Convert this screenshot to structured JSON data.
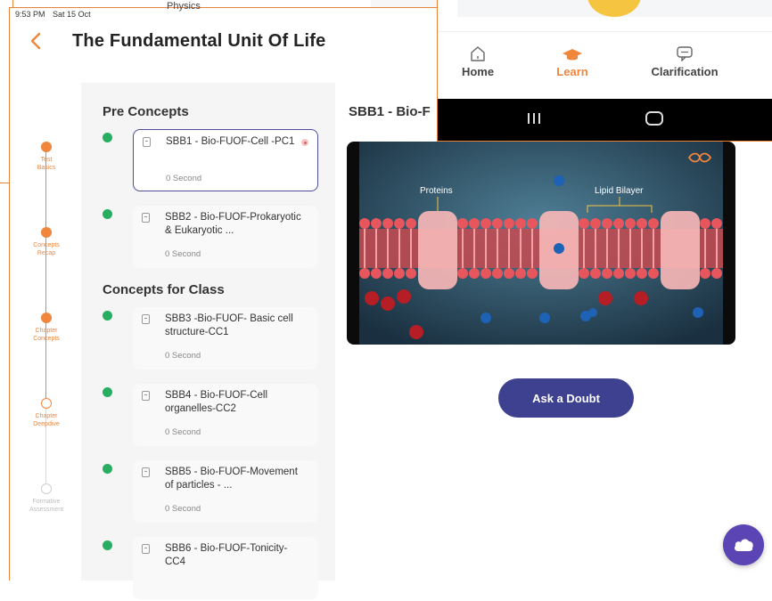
{
  "status_bar": {
    "time": "9:53 PM",
    "date": "Sat 15 Oct"
  },
  "top_cut_text": "Physics",
  "header": {
    "back_icon": "chevron-left-icon",
    "title": "The Fundamental Unit Of Life"
  },
  "stepper": [
    {
      "label_lines": [
        "Test",
        "Basics"
      ],
      "state": "done"
    },
    {
      "label_lines": [
        "Concepts",
        "Recap"
      ],
      "state": "done"
    },
    {
      "label_lines": [
        "Chapter",
        "Concepts"
      ],
      "state": "done"
    },
    {
      "label_lines": [
        "Chapter",
        "Deepdive"
      ],
      "state": "current"
    },
    {
      "label_lines": [
        "Formative",
        "Assessment"
      ],
      "state": "locked"
    }
  ],
  "sections": {
    "pre_concepts": "Pre Concepts",
    "concepts_for_class": "Concepts for Class"
  },
  "concepts": [
    {
      "title": "SBB1 - Bio-FUOF-Cell -PC1",
      "duration": "0 Second",
      "selected": true
    },
    {
      "title": "SBB2 - Bio-FUOF-Prokaryotic & Eukaryotic ...",
      "duration": "0 Second",
      "selected": false
    },
    {
      "title": "SBB3 -Bio-FUOF- Basic cell structure-CC1",
      "duration": "0 Second",
      "selected": false
    },
    {
      "title": "SBB4 - Bio-FUOF-Cell organelles-CC2",
      "duration": "0 Second",
      "selected": false
    },
    {
      "title": "SBB5 - Bio-FUOF-Movement of particles - ...",
      "duration": "0 Second",
      "selected": false
    },
    {
      "title": "SBB6 - Bio-FUOF-Tonicity-CC4",
      "duration": "",
      "selected": false
    }
  ],
  "video": {
    "title": "SBB1 - Bio-F",
    "label_proteins": "Proteins",
    "label_lipid": "Lipid Bilayer"
  },
  "ask_doubt_label": "Ask a Doubt",
  "chat_fab_icon": "cloud-chat-icon",
  "phone_tabs": [
    {
      "label": "Home",
      "icon": "home-icon",
      "active": false
    },
    {
      "label": "Learn",
      "icon": "graduation-cap-icon",
      "active": true
    },
    {
      "label": "Clarification",
      "icon": "chat-bubble-icon",
      "active": false
    }
  ],
  "nav_bar": [
    "recents-icon",
    "home-button-icon"
  ],
  "colors": {
    "accent_orange": "#f0863c",
    "primary_indigo": "#3e4090",
    "success_green": "#27ae60",
    "fab_purple": "#5b45b5"
  }
}
